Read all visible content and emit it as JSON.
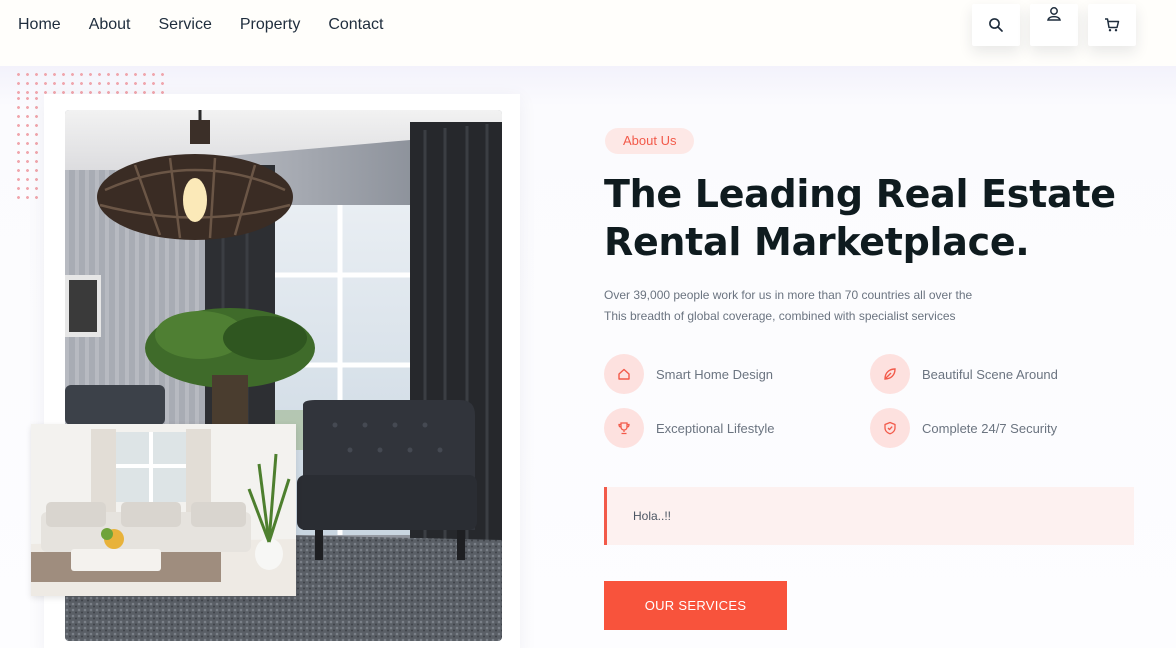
{
  "nav": {
    "items": [
      {
        "label": "Home"
      },
      {
        "label": "About"
      },
      {
        "label": "Service"
      },
      {
        "label": "Property"
      },
      {
        "label": "Contact"
      }
    ]
  },
  "header_icons": {
    "search": "search-icon",
    "user": "user-icon",
    "cart": "cart-icon"
  },
  "hero": {
    "badge": "About Us",
    "title_line1": "The Leading Real Estate",
    "title_line2": "Rental Marketplace.",
    "description_line1": "Over 39,000 people work for us in more than 70 countries all over the",
    "description_line2": "This breadth of global coverage, combined with specialist services",
    "features": [
      {
        "label": "Smart Home Design",
        "icon": "home-icon"
      },
      {
        "label": "Beautiful Scene Around",
        "icon": "leaf-icon"
      },
      {
        "label": "Exceptional Lifestyle",
        "icon": "trophy-icon"
      },
      {
        "label": "Complete 24/7 Security",
        "icon": "shield-icon"
      }
    ],
    "quote": "Hola..!!",
    "cta_label": "OUR SERVICES"
  },
  "colors": {
    "accent": "#f8533c",
    "accent_soft": "#fde8e6",
    "heading": "#0f1b1f",
    "body_text": "#6b7480"
  }
}
